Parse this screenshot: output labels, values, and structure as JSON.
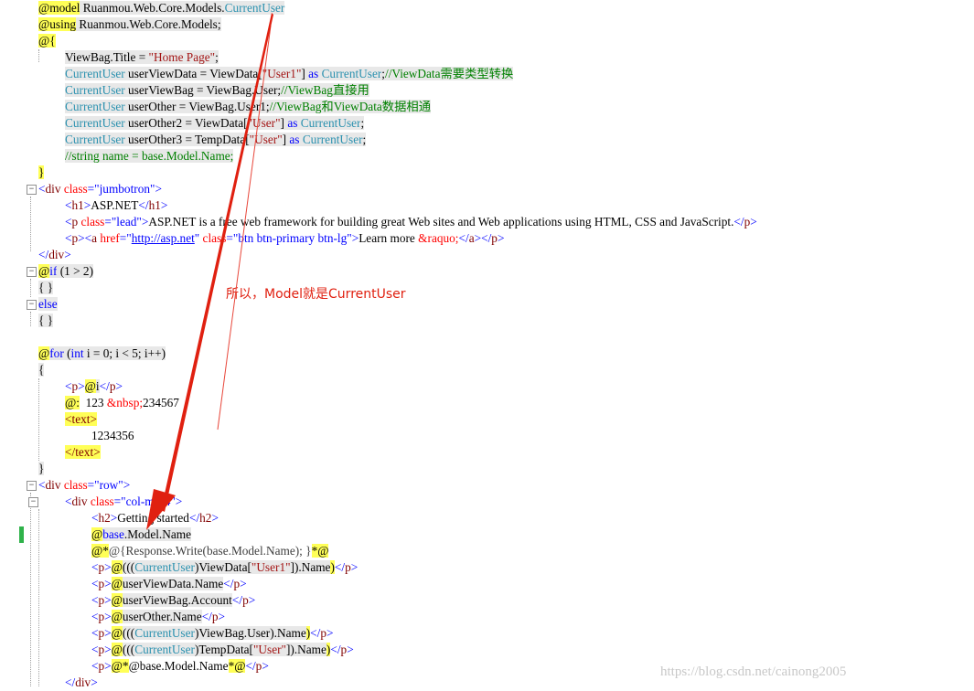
{
  "code": {
    "l01": {
      "a": "@model",
      "b": " Ruanmou.Web.Core.Models.",
      "c": "CurrentUser"
    },
    "l02": {
      "a": "@using",
      "b": " Ruanmou.Web.Core.Models;"
    },
    "l03": {
      "a": "@{"
    },
    "l04": {
      "a": "ViewBag.Title = ",
      "b": "\"Home Page\"",
      "c": ";"
    },
    "l05": {
      "a": "CurrentUser",
      "b": " userViewData = ViewData[",
      "c": "\"User1\"",
      "d": "] ",
      "e": "as",
      "f": " ",
      "g": "CurrentUser",
      "h": ";",
      "i": "//ViewData需要类型转换"
    },
    "l06": {
      "a": "CurrentUser",
      "b": " userViewBag = ViewBag.User;",
      "c": "//ViewBag直接用"
    },
    "l07": {
      "a": "CurrentUser",
      "b": " userOther = ViewBag.User1;",
      "c": "//ViewBag和ViewData数据相通"
    },
    "l08": {
      "a": "CurrentUser",
      "b": " userOther2 = ViewData[",
      "c": "\"User\"",
      "d": "] ",
      "e": "as",
      "f": " ",
      "g": "CurrentUser",
      "h": ";"
    },
    "l09": {
      "a": "CurrentUser",
      "b": " userOther3 = TempData[",
      "c": "\"User\"",
      "d": "] ",
      "e": "as",
      "f": " ",
      "g": "CurrentUser",
      "h": ";"
    },
    "l10": {
      "a": "//string name = base.Model.Name;"
    },
    "l11": {
      "a": "}"
    },
    "l12": {
      "a": "<",
      "b": "div",
      "c": " class",
      "d": "=",
      "e": "\"jumbotron\"",
      "f": ">"
    },
    "l13": {
      "a": "<",
      "b": "h1",
      "c": ">",
      "d": "ASP.NET",
      "e": "</",
      "f": "h1",
      "g": ">"
    },
    "l14": {
      "a": "<",
      "b": "p",
      "c": " class",
      "d": "=",
      "e": "\"lead\"",
      "f": ">",
      "g": "ASP.NET is a free web framework for building great Web sites and Web applications using HTML, CSS and JavaScript.",
      "h": "</",
      "i": "p",
      "j": ">"
    },
    "l15": {
      "a": "<",
      "b": "p",
      "c": "><",
      "d": "a",
      "e": " href",
      "f": "=",
      "g": "\"",
      "h": "http://asp.net",
      "i": "\"",
      "j": " class",
      "k": "=",
      "l": "\"btn btn-primary btn-lg\"",
      "m": ">",
      "n": "Learn more ",
      "o": "&raquo;",
      "p": "</",
      "q": "a",
      "r": "></",
      "s": "p",
      "t": ">"
    },
    "l16": {
      "a": "</",
      "b": "div",
      "c": ">"
    },
    "l17": {
      "a": "@",
      "b": "if",
      "c": " (1 > 2)"
    },
    "l18": {
      "a": "{ }"
    },
    "l19": {
      "a": "else"
    },
    "l20": {
      "a": "{ }"
    },
    "l21": {
      "a": "@",
      "b": "for",
      "c": " (",
      "d": "int",
      "e": " i = 0; i < 5; i++)"
    },
    "l22": {
      "a": "{"
    },
    "l23": {
      "a": "<",
      "b": "p",
      "c": ">",
      "d": "@",
      "e": "i",
      "f": "</",
      "g": "p",
      "h": ">"
    },
    "l24": {
      "a": "@:",
      "b": "  123 ",
      "c": "&nbsp;",
      "d": "234567"
    },
    "l25": {
      "a": "<text>"
    },
    "l26": {
      "a": "1234356"
    },
    "l27": {
      "a": "</text>"
    },
    "l28": {
      "a": "}"
    },
    "l29": {
      "a": "<",
      "b": "div",
      "c": " class",
      "d": "=",
      "e": "\"row\"",
      "f": ">"
    },
    "l30": {
      "a": "<",
      "b": "div",
      "c": " class",
      "d": "=",
      "e": "\"col-md-4\"",
      "f": ">"
    },
    "l31": {
      "a": "<",
      "b": "h2",
      "c": ">",
      "d": "Getting started",
      "e": "</",
      "f": "h2",
      "g": ">"
    },
    "l32": {
      "a": "@",
      "b": "base",
      "c": ".Model.Name"
    },
    "l33": {
      "a": "@*",
      "b": "@{Response.Write(base.Model.Name); }",
      "c": "*@"
    },
    "l34": {
      "a": "<",
      "b": "p",
      "c": ">",
      "d": "@",
      "e": "(((",
      "f": "CurrentUser",
      "g": ")ViewData[",
      "h": "\"User1\"",
      "i": "]).Name",
      "j": ")",
      "k": "</",
      "l": "p",
      "m": ">"
    },
    "l35": {
      "a": "<",
      "b": "p",
      "c": ">",
      "d": "@",
      "e": "userViewData.Name",
      "f": "</",
      "g": "p",
      "h": ">"
    },
    "l36": {
      "a": "<",
      "b": "p",
      "c": ">",
      "d": "@",
      "e": "userViewBag.Account",
      "f": "</",
      "g": "p",
      "h": ">"
    },
    "l37": {
      "a": "<",
      "b": "p",
      "c": ">",
      "d": "@",
      "e": "userOther.Name",
      "f": "</",
      "g": "p",
      "h": ">"
    },
    "l38": {
      "a": "<",
      "b": "p",
      "c": ">",
      "d": "@",
      "e": "(((",
      "f": "CurrentUser",
      "g": ")ViewBag.User).Name",
      "h": ")",
      "i": "</",
      "j": "p",
      "k": ">"
    },
    "l39": {
      "a": "<",
      "b": "p",
      "c": ">",
      "d": "@",
      "e": "(((",
      "f": "CurrentUser",
      "g": ")TempData[",
      "h": "\"User\"",
      "i": "]).Name",
      "j": ")",
      "k": "</",
      "l": "p",
      "m": ">"
    },
    "l40": {
      "a": "<",
      "b": "p",
      "c": ">",
      "d": "@*",
      "e": "@base.Model.Name",
      "f": "*@",
      "g": "</",
      "h": "p",
      "i": ">"
    },
    "l41": {
      "a": "</",
      "b": "div",
      "c": ">"
    }
  },
  "annotation": {
    "text": "所以，Model就是CurrentUser",
    "color": "#e02010"
  },
  "watermark": {
    "text": "https://blog.csdn.net/cainong2005"
  },
  "fold_glyph": "−",
  "colors": {
    "keyword": "#0000ff",
    "type": "#2b91af",
    "string": "#a31515",
    "comment": "#008000",
    "tag": "#800000",
    "attr": "#ff0000",
    "razor_highlight": "#ffff57",
    "code_block_bg": "#e8e8e8",
    "change_bar": "#2fb24a"
  }
}
